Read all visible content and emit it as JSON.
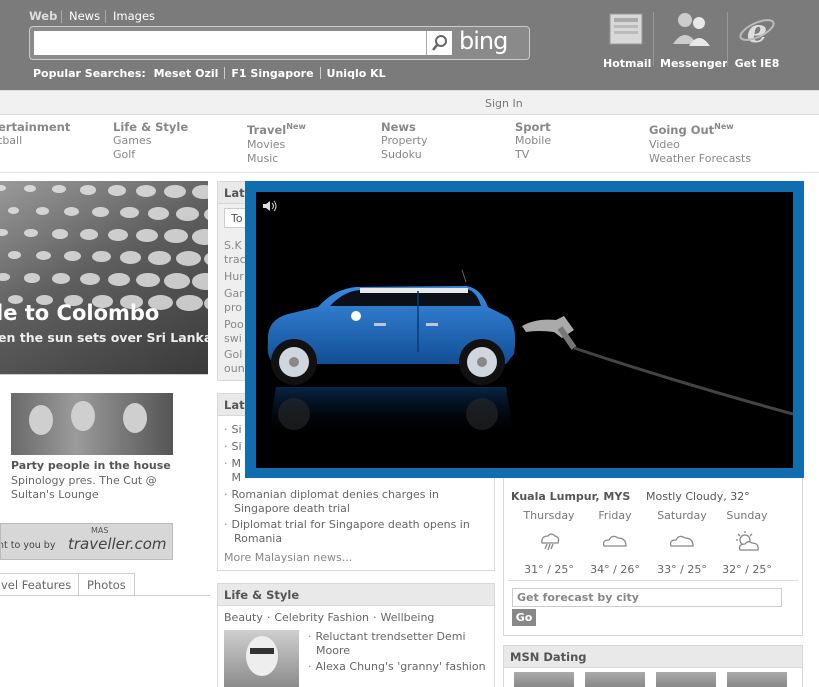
{
  "header": {
    "tabs": [
      "Web",
      "News",
      "Images"
    ],
    "search": {
      "value": "",
      "placeholder": ""
    },
    "logo": "bing",
    "popular_label": "Popular Searches:",
    "popular": [
      "Meset Ozil",
      "F1 Singapore",
      "Uniqlo KL"
    ],
    "icons": [
      {
        "label": "Hotmail",
        "icon": "hotmail-icon"
      },
      {
        "label": "Messenger",
        "icon": "messenger-icon"
      },
      {
        "label": "Get IE8",
        "icon": "ie-icon"
      }
    ]
  },
  "signin": "Sign In",
  "nav": [
    {
      "head": "ertainment",
      "new": "",
      "subs": [
        "tball"
      ]
    },
    {
      "head": "Life & Style",
      "new": "",
      "subs": [
        "Games",
        "Golf"
      ]
    },
    {
      "head": "Travel",
      "new": "New",
      "subs": [
        "Movies",
        "Music"
      ]
    },
    {
      "head": "News",
      "new": "",
      "subs": [
        "Property",
        "Sudoku"
      ]
    },
    {
      "head": "Sport",
      "new": "",
      "subs": [
        "Mobile",
        "TV"
      ]
    },
    {
      "head": "Going Out",
      "new": "New",
      "subs": [
        "Video",
        "Weather Forecasts"
      ]
    }
  ],
  "hero": {
    "title": "le to Colombo",
    "subtitle": "en the sun sets over Sri Lanka"
  },
  "party": {
    "title": "Party people in the house",
    "desc": "Spinology pres. The Cut @ Sultan's Lounge"
  },
  "banner": {
    "text": "ht to you by",
    "logo_small": "MAS",
    "logo": "traveller.com"
  },
  "bottom_tabs": [
    "vel Features",
    "Photos"
  ],
  "news_top": {
    "head": "Lat",
    "tab": "To",
    "items": [
      "S.K",
      "trac",
      "Hur",
      "Gar",
      "pro",
      "Poo",
      "swi",
      "Gol",
      "oun"
    ]
  },
  "news": {
    "head": "Lat",
    "items": [
      "Si",
      "Si",
      "M",
      "M",
      "Romanian diplomat denies charges in Singapore death trial",
      "Diplomat trial for Singapore death opens in Romania"
    ],
    "more": "More Malaysian news..."
  },
  "life": {
    "head": "Life & Style",
    "links": [
      "Beauty",
      "Celebrity Fashion",
      "Wellbeing"
    ],
    "items": [
      "Reluctant trendsetter Demi Moore",
      "Alexa Chung's 'granny' fashion"
    ]
  },
  "weather": {
    "city": "Kuala Lumpur, MYS",
    "condition": "Mostly Cloudy, 32°",
    "days": [
      {
        "day": "Thursday",
        "icon": "storm-icon",
        "temp": "31° / 25°"
      },
      {
        "day": "Friday",
        "icon": "cloud-icon",
        "temp": "34° / 26°"
      },
      {
        "day": "Saturday",
        "icon": "cloud-icon",
        "temp": "33° / 25°"
      },
      {
        "day": "Sunday",
        "icon": "sun-cloud-icon",
        "temp": "32° / 25°"
      }
    ],
    "forecast_placeholder": "Get forecast by city",
    "go": "Go"
  },
  "dating": {
    "head": "MSN Dating"
  },
  "colors": {
    "header": "#7b7b7b",
    "ad_border": "#0f6db0",
    "car": "#1e63b4"
  }
}
